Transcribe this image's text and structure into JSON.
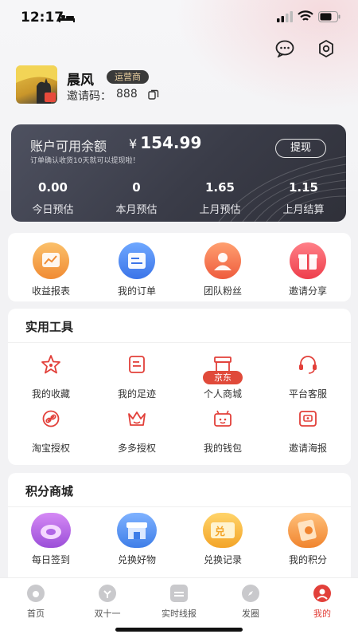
{
  "status_bar": {
    "time": "12:17"
  },
  "header": {
    "message_icon": "chat-bubble-icon",
    "settings_icon": "gear-icon"
  },
  "profile": {
    "name": "晨风",
    "role_badge": "运营商",
    "invite_label": "邀请码：",
    "invite_code": "888"
  },
  "balance": {
    "label": "账户可用余额",
    "currency": "¥",
    "amount": "154.99",
    "note": "订单确认收货10天就可以提现啦！",
    "withdraw_label": "提现",
    "stats": [
      {
        "value": "0.00",
        "label": "今日预估"
      },
      {
        "value": "0",
        "label": "本月预估"
      },
      {
        "value": "1.65",
        "label": "上月预估"
      },
      {
        "value": "1.15",
        "label": "上月结算"
      }
    ]
  },
  "quick_actions": [
    {
      "label": "收益报表",
      "icon": "chart-report-icon",
      "color": "#f6a94a"
    },
    {
      "label": "我的订单",
      "icon": "order-list-icon",
      "color": "#4d8df3"
    },
    {
      "label": "团队粉丝",
      "icon": "team-user-icon",
      "color": "#f57a4e"
    },
    {
      "label": "邀请分享",
      "icon": "gift-icon",
      "color": "#f3535b"
    }
  ],
  "tools": {
    "title": "实用工具",
    "items": [
      {
        "label": "我的收藏",
        "icon": "star-icon"
      },
      {
        "label": "我的足迹",
        "icon": "footprint-icon"
      },
      {
        "label": "个人商城",
        "icon": "shop-icon",
        "badge": "京东"
      },
      {
        "label": "平台客服",
        "icon": "headset-icon"
      },
      {
        "label": "淘宝授权",
        "icon": "link-icon"
      },
      {
        "label": "多多授权",
        "icon": "crown-icon"
      },
      {
        "label": "我的钱包",
        "icon": "wallet-icon"
      },
      {
        "label": "邀请海报",
        "icon": "poster-icon"
      }
    ]
  },
  "points_mall": {
    "title": "积分商城",
    "items": [
      {
        "label": "每日签到",
        "icon": "sign-in-icon",
        "color": "#b35de0"
      },
      {
        "label": "兑换好物",
        "icon": "store-icon",
        "color": "#4b8cf0"
      },
      {
        "label": "兑换记录",
        "icon": "exchange-record-icon",
        "color": "#f4b12a",
        "text": "兑"
      },
      {
        "label": "我的积分",
        "icon": "points-icon",
        "color": "#f39a3c"
      }
    ]
  },
  "tabbar": [
    {
      "label": "首页",
      "icon": "home-icon",
      "active": false
    },
    {
      "label": "双十一",
      "icon": "double-eleven-icon",
      "active": false
    },
    {
      "label": "实时线报",
      "icon": "news-icon",
      "active": false
    },
    {
      "label": "发圈",
      "icon": "compass-icon",
      "active": false
    },
    {
      "label": "我的",
      "icon": "profile-icon",
      "active": true
    }
  ],
  "colors": {
    "accent": "#e2403a",
    "card_dark": "#3c3e4a"
  }
}
